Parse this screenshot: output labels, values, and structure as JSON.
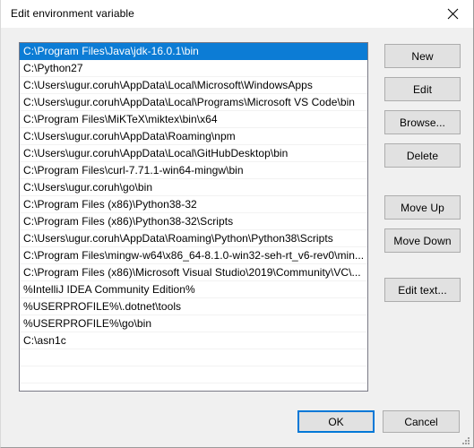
{
  "window": {
    "title": "Edit environment variable",
    "close_icon": "close-icon"
  },
  "list": {
    "selected_index": 0,
    "items": [
      "C:\\Program Files\\Java\\jdk-16.0.1\\bin",
      "C:\\Python27",
      "C:\\Users\\ugur.coruh\\AppData\\Local\\Microsoft\\WindowsApps",
      "C:\\Users\\ugur.coruh\\AppData\\Local\\Programs\\Microsoft VS Code\\bin",
      "C:\\Program Files\\MiKTeX\\miktex\\bin\\x64",
      "C:\\Users\\ugur.coruh\\AppData\\Roaming\\npm",
      "C:\\Users\\ugur.coruh\\AppData\\Local\\GitHubDesktop\\bin",
      "C:\\Program Files\\curl-7.71.1-win64-mingw\\bin",
      "C:\\Users\\ugur.coruh\\go\\bin",
      "C:\\Program Files (x86)\\Python38-32",
      "C:\\Program Files (x86)\\Python38-32\\Scripts",
      "C:\\Users\\ugur.coruh\\AppData\\Roaming\\Python\\Python38\\Scripts",
      "C:\\Program Files\\mingw-w64\\x86_64-8.1.0-win32-seh-rt_v6-rev0\\min...",
      "C:\\Program Files (x86)\\Microsoft Visual Studio\\2019\\Community\\VC\\...",
      "%IntelliJ IDEA Community Edition%",
      "%USERPROFILE%\\.dotnet\\tools",
      "%USERPROFILE%\\go\\bin",
      "C:\\asn1c"
    ],
    "empty_row_count": 3
  },
  "side_buttons": {
    "new": "New",
    "edit": "Edit",
    "browse": "Browse...",
    "delete": "Delete",
    "move_up": "Move Up",
    "move_down": "Move Down",
    "edit_text": "Edit text..."
  },
  "footer": {
    "ok": "OK",
    "cancel": "Cancel"
  },
  "colors": {
    "selection": "#0c7cd5",
    "focus_ring": "#0078d7",
    "dialog_bg": "#f0f0f0",
    "button_bg": "#e1e1e1",
    "list_bg": "#ffffff"
  }
}
